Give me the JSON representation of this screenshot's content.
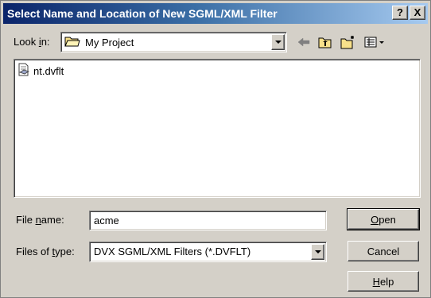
{
  "window": {
    "title": "Select Name and Location of New SGML/XML Filter",
    "help_button": "?",
    "close_button": "X"
  },
  "lookin": {
    "label_pre": "Look ",
    "label_accel": "i",
    "label_post": "n:",
    "value": "My Project"
  },
  "toolbar": {
    "back": "back-arrow-icon",
    "up": "up-one-level-icon",
    "new_folder": "new-folder-icon",
    "view": "view-menu-icon"
  },
  "files": [
    {
      "name": "nt.dvflt"
    }
  ],
  "filename": {
    "label_pre": "File ",
    "label_accel": "n",
    "label_post": "ame:",
    "value": "acme"
  },
  "filetype": {
    "label_pre": "Files of ",
    "label_accel": "t",
    "label_post": "ype:",
    "value": "DVX SGML/XML Filters (*.DVFLT)"
  },
  "buttons": {
    "open_accel": "O",
    "open_rest": "pen",
    "cancel": "Cancel",
    "help_accel": "H",
    "help_rest": "elp"
  },
  "colors": {
    "face": "#d4d0c8",
    "titlebar_start": "#0a246a",
    "titlebar_end": "#a6caf0"
  }
}
